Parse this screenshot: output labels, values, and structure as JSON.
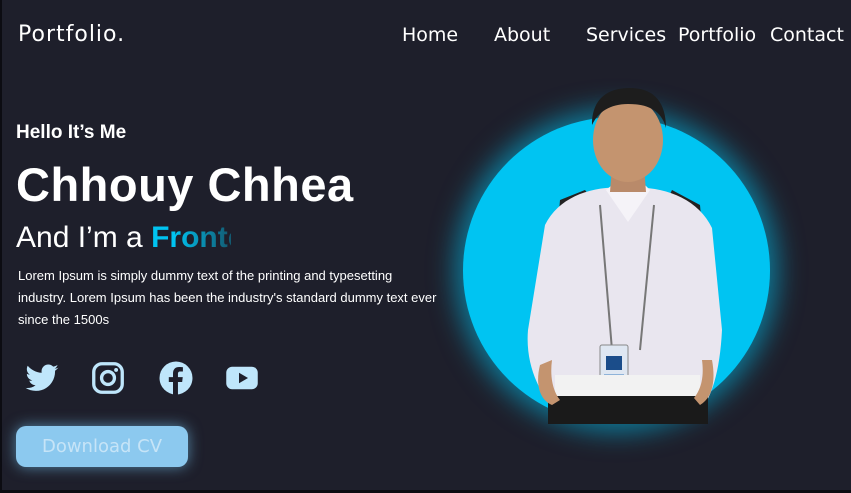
{
  "header": {
    "logo": "Portfolio.",
    "nav": [
      "Home",
      "About",
      "Services",
      "Portfolio",
      "Contact"
    ]
  },
  "hero": {
    "greeting": "Hello It’s Me",
    "name": "Chhouy Chhea",
    "role_prefix": "And I’m a",
    "role_typed": "Fronte",
    "description": "Lorem Ipsum is simply dummy text of the printing and typesetting industry. Lorem Ipsum has been the industry's standard dummy text ever since the 1500s",
    "download_label": "Download CV",
    "socials": [
      "twitter-icon",
      "instagram-icon",
      "facebook-icon",
      "youtube-icon"
    ]
  },
  "colors": {
    "background": "#1e1f2b",
    "accent": "#00c4f2",
    "button": "#8cc9ef"
  }
}
